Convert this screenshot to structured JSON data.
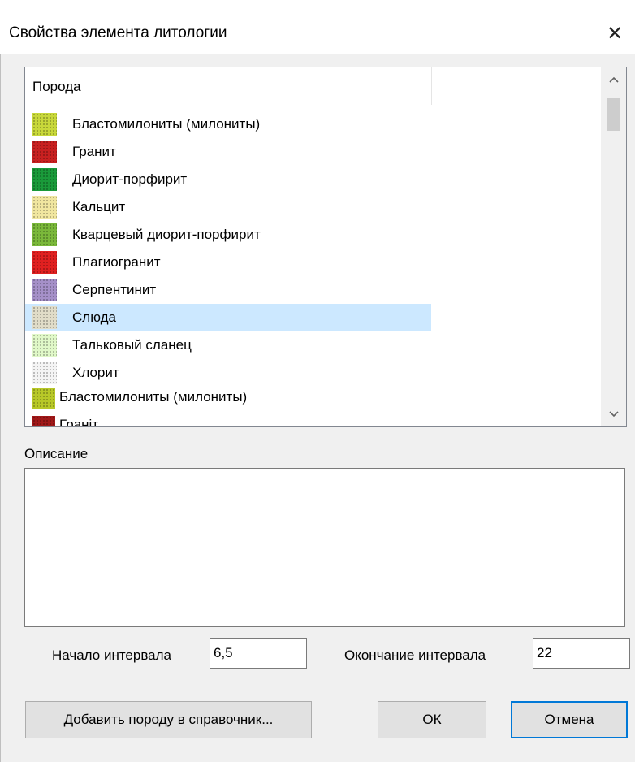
{
  "window": {
    "title": "Свойства элемента литологии",
    "close_glyph": "✕"
  },
  "rock_list": {
    "column_header": "Порода",
    "items": [
      {
        "label": "Бластомилониты (милониты)",
        "color": "#c8d83a"
      },
      {
        "label": "Гранит",
        "color": "#c82020"
      },
      {
        "label": "Диорит-порфирит",
        "color": "#1a9a3a"
      },
      {
        "label": "Кальцит",
        "color": "#f0e6a0"
      },
      {
        "label": "Кварцевый диорит-порфирит",
        "color": "#7ab83a"
      },
      {
        "label": "Плагиогранит",
        "color": "#e02020"
      },
      {
        "label": "Серпентинит",
        "color": "#a590c8"
      },
      {
        "label": "Слюда",
        "color": "#e0dcc8"
      },
      {
        "label": "Тальковый сланец",
        "color": "#e0f8c8"
      },
      {
        "label": "Хлорит",
        "color": "#f4f4f4"
      },
      {
        "label": "Бластомилониты (милониты)",
        "color": "#b8c828"
      },
      {
        "label": "Граніт",
        "color": "#a01818"
      }
    ],
    "selected_index": 7,
    "scroll_up_icon": "chevron-up-icon",
    "scroll_down_icon": "chevron-down-icon"
  },
  "description": {
    "label": "Описание",
    "value": ""
  },
  "interval": {
    "start_label": "Начало интервала",
    "start_value": "6,5",
    "end_label": "Окончание интервала",
    "end_value": "22"
  },
  "buttons": {
    "add_rock": "Добавить породу в справочник...",
    "ok": "ОК",
    "cancel": "Отмена"
  }
}
